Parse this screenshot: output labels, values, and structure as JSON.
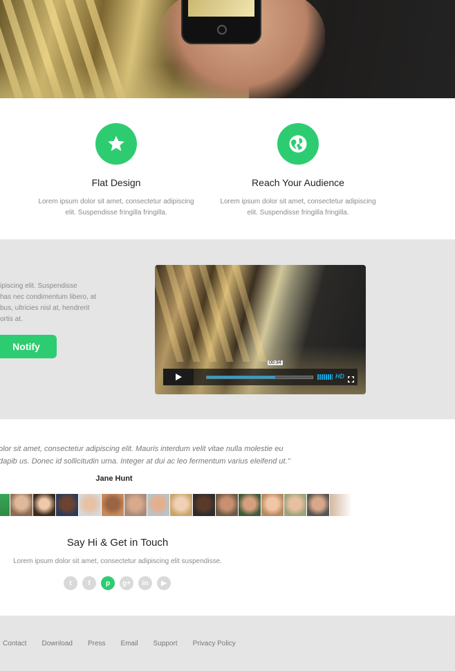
{
  "features": [
    {
      "title": "Flat Design",
      "text": "Lorem ipsum dolor sit amet, consectetur adipiscing elit. Suspendisse fringilla fringilla.",
      "icon": "star-icon"
    },
    {
      "title": "Reach Your Audience",
      "text": "Lorem ipsum dolor sit amet, consectetur adipiscing elit. Suspendisse fringilla fringilla.",
      "icon": "globe-icon"
    }
  ],
  "video_section": {
    "lead_lines": [
      "ipiscing elit. Suspendisse",
      "has nec condimentum libero, at",
      "bus, ultricies nisl at, hendrerit",
      "ortis at."
    ],
    "notify_label": "Notify",
    "player": {
      "time": "00:34",
      "hd": "HD",
      "progress": 0.65
    }
  },
  "testimonial": {
    "quote_lines": [
      "olor sit amet, consectetur adipiscing elit. Mauris interdum velit vitae nulla molestie eu",
      "dapib us. Donec id sollicitudin urna. Integer at dui ac leo fermentum varius eleifend ut.\""
    ],
    "author": "Jane Hunt"
  },
  "contact": {
    "title": "Say Hi & Get in Touch",
    "text": "Lorem ipsum dolor sit amet, consectetur adipiscing elit suspendisse.",
    "social": [
      {
        "icon": "twitter-icon",
        "glyph": "t"
      },
      {
        "icon": "facebook-icon",
        "glyph": "f"
      },
      {
        "icon": "pinterest-icon",
        "glyph": "p"
      },
      {
        "icon": "google-plus-icon",
        "glyph": "g+"
      },
      {
        "icon": "linkedin-icon",
        "glyph": "in"
      },
      {
        "icon": "youtube-icon",
        "glyph": "▶"
      }
    ]
  },
  "footer": {
    "links": [
      "Contact",
      "Download",
      "Press",
      "Email",
      "Support",
      "Privacy Policy"
    ]
  },
  "colors": {
    "accent": "#2ecc71",
    "player_blue": "#1aa6e0",
    "gray_band": "#e5e5e5"
  }
}
